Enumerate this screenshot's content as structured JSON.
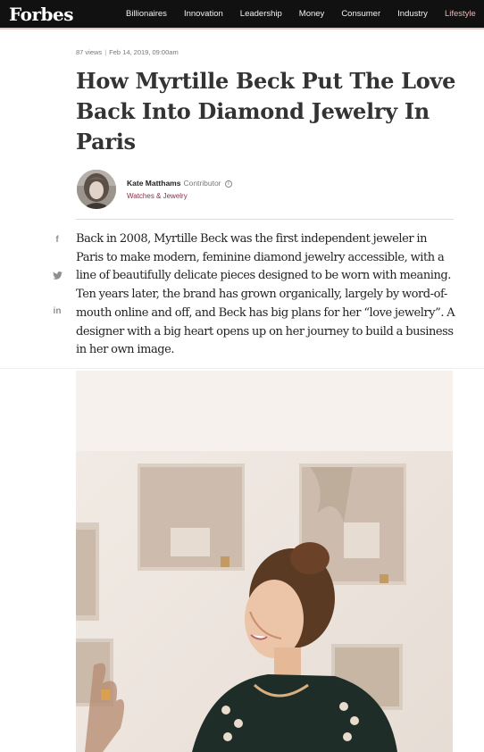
{
  "brand": {
    "logo": "Forbes"
  },
  "nav": {
    "items": [
      "Billionaires",
      "Innovation",
      "Leadership",
      "Money",
      "Consumer",
      "Industry",
      "Lifestyle"
    ]
  },
  "meta": {
    "views": "87 views",
    "date": "Feb 14, 2019, 09:00am"
  },
  "article": {
    "title": "How Myrtille Beck Put The Love Back Into Diamond Jewelry In Paris",
    "lead": "Back in 2008, Myrtille Beck was the first independent jeweler in Paris to make modern, feminine diamond jewelry accessible, with a line of beautifully delicate pieces designed to be worn with meaning. Ten years later, the brand has grown organically, largely by word-of-mouth online and off, and Beck has big plans for her “love jewelry”. A designer with a big heart opens up on her journey to build a business in her own image."
  },
  "author": {
    "name": "Kate Matthams",
    "role": "Contributor",
    "info_glyph": "i",
    "section": "Watches & Jewelry"
  },
  "share": {
    "facebook": "f",
    "twitter": "🐦",
    "linkedin": "in"
  },
  "colors": {
    "nav_bg": "#111111",
    "accent": "#8b2f47",
    "text": "#333333"
  }
}
